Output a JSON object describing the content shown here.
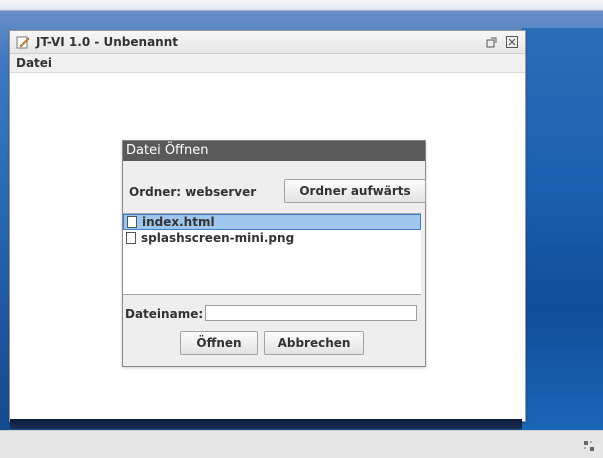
{
  "window": {
    "title": "JT-VI 1.0 - Unbenannt",
    "icons": {
      "app": "pencil-app-icon",
      "restore": "restore-icon",
      "close": "close-icon"
    }
  },
  "menubar": {
    "items": [
      {
        "label": "Datei"
      }
    ]
  },
  "dialog": {
    "title": "Datei Öffnen",
    "folder_label": "Ordner: webserver",
    "folder_up_label": "Ordner aufwärts",
    "files": [
      {
        "name": "index.html",
        "selected": true
      },
      {
        "name": "splashscreen-mini.png",
        "selected": false
      }
    ],
    "filename_label": "Dateiname:",
    "filename_value": "",
    "open_label": "Öffnen",
    "cancel_label": "Abbrechen"
  },
  "colors": {
    "dialog_title_bg": "#595959",
    "selection_bg": "#9ec6ef",
    "selection_border": "#3d7fc4",
    "desktop_blue": "#2f6fb6"
  }
}
